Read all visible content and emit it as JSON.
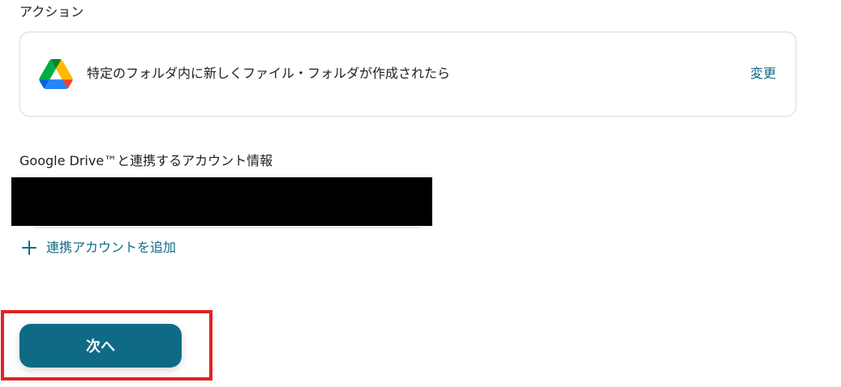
{
  "section": {
    "title": "アクション"
  },
  "action_card": {
    "service_icon": "google-drive-icon",
    "text": "特定のフォルダ内に新しくファイル・フォルダが作成されたら",
    "change_label": "変更"
  },
  "account": {
    "heading": "Google Drive™と連携するアカウント情報",
    "add_label": "連携アカウントを追加",
    "add_icon": "plus-icon"
  },
  "footer": {
    "next_label": "次へ"
  },
  "colors": {
    "accent": "#0f6b85",
    "highlight": "#e02424",
    "card_border": "#d9d9d9"
  }
}
